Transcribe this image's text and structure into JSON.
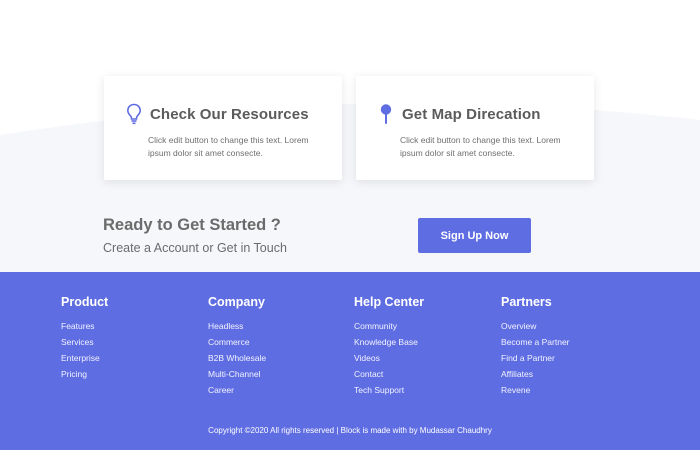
{
  "colors": {
    "accent": "#5f6de2",
    "section_bg": "#f6f7fb",
    "heading": "#5b5b5b"
  },
  "cards": [
    {
      "icon": "lightbulb-icon",
      "title": "Check Our Resources",
      "text": "Click edit button to change this text. Lorem ipsum dolor sit amet consecte."
    },
    {
      "icon": "map-pin-icon",
      "title": "Get Map Direcation",
      "text": "Click edit button to change this text. Lorem ipsum dolor sit amet consecte."
    }
  ],
  "cta": {
    "title": "Ready to Get Started ?",
    "subtitle": "Create a Account or Get in Touch",
    "button_label": "Sign Up Now"
  },
  "footer": {
    "columns": [
      {
        "heading": "Product",
        "links": [
          "Features",
          "Services",
          "Enterprise",
          "Pricing"
        ]
      },
      {
        "heading": "Company",
        "links": [
          "Headless",
          "Commerce",
          "B2B Wholesale",
          "Multi-Channel",
          "Career"
        ]
      },
      {
        "heading": "Help Center",
        "links": [
          "Community",
          "Knowledge Base",
          "Videos",
          "Contact",
          "Tech Support"
        ]
      },
      {
        "heading": "Partners",
        "links": [
          "Overview",
          "Become a Partner",
          "Find a Partner",
          "Affiliates",
          "Revene"
        ]
      }
    ],
    "copyright": "Copyright ©2020 All rights reserved | Block is made with by Mudassar Chaudhry"
  }
}
